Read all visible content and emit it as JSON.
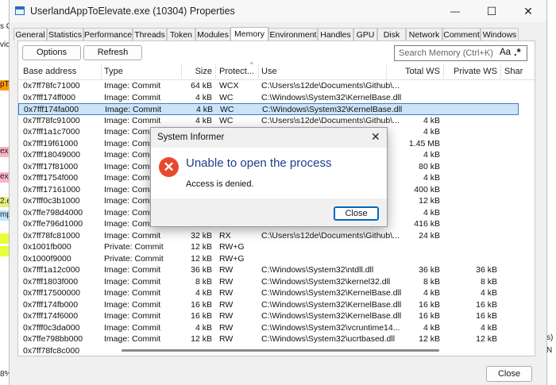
{
  "window": {
    "title": "UserlandAppToElevate.exe (10304) Properties",
    "minimize": "—",
    "maximize": "☐",
    "close": "✕"
  },
  "tabs": [
    {
      "label": "General"
    },
    {
      "label": "Statistics"
    },
    {
      "label": "Performance"
    },
    {
      "label": "Threads"
    },
    {
      "label": "Token"
    },
    {
      "label": "Modules"
    },
    {
      "label": "Memory"
    },
    {
      "label": "Environment"
    },
    {
      "label": "Handles"
    },
    {
      "label": "GPU"
    },
    {
      "label": "Disk"
    },
    {
      "label": "Network"
    },
    {
      "label": "Comment"
    },
    {
      "label": "Windows"
    }
  ],
  "active_tab": "Memory",
  "toolbar": {
    "options_label": "Options",
    "refresh_label": "Refresh",
    "search_placeholder": "Search Memory (Ctrl+K)",
    "case_toggle": "Aa",
    "regex_toggle": ".*"
  },
  "columns": {
    "base_address": "Base address",
    "type": "Type",
    "size": "Size",
    "protection": "Protect...",
    "use": "Use",
    "total_ws": "Total WS",
    "private_ws": "Private WS",
    "shared": "Shar"
  },
  "rows": [
    {
      "base": "0x7ff78fc71000",
      "type": "Image: Commit",
      "size": "64 kB",
      "prot": "WCX",
      "use": "C:\\Users\\s12de\\Documents\\Github\\...",
      "total": "",
      "priv": ""
    },
    {
      "base": "0x7fff174ff000",
      "type": "Image: Commit",
      "size": "4 kB",
      "prot": "WC",
      "use": "C:\\Windows\\System32\\KernelBase.dll",
      "total": "",
      "priv": ""
    },
    {
      "base": "0x7fff174fa000",
      "type": "Image: Commit",
      "size": "4 kB",
      "prot": "WC",
      "use": "C:\\Windows\\System32\\KernelBase.dll",
      "total": "",
      "priv": ""
    },
    {
      "base": "0x7ff78fc91000",
      "type": "Image: Commit",
      "size": "4 kB",
      "prot": "WC",
      "use": "C:\\Users\\s12de\\Documents\\Github\\...",
      "total": "4 kB",
      "priv": ""
    },
    {
      "base": "0x7fff1a1c7000",
      "type": "Image: Commit",
      "size": "",
      "prot": "",
      "use": "",
      "total": "4 kB",
      "priv": ""
    },
    {
      "base": "0x7fff19f61000",
      "type": "Image: Commit",
      "size": "",
      "prot": "",
      "use": "",
      "total": "1.45 MB",
      "priv": ""
    },
    {
      "base": "0x7fff18049000",
      "type": "Image: Commit",
      "size": "",
      "prot": "",
      "use": "",
      "total": "4 kB",
      "priv": ""
    },
    {
      "base": "0x7fff17f81000",
      "type": "Image: Commit",
      "size": "",
      "prot": "",
      "use": "",
      "total": "80 kB",
      "priv": ""
    },
    {
      "base": "0x7fff1754f000",
      "type": "Image: Commit",
      "size": "",
      "prot": "",
      "use": "",
      "total": "4 kB",
      "priv": ""
    },
    {
      "base": "0x7fff17161000",
      "type": "Image: Commit",
      "size": "",
      "prot": "",
      "use": "",
      "total": "400 kB",
      "priv": ""
    },
    {
      "base": "0x7fff0c3b1000",
      "type": "Image: Commit",
      "size": "",
      "prot": "",
      "use": "",
      "total": "12 kB",
      "priv": ""
    },
    {
      "base": "0x7ffe798d4000",
      "type": "Image: Commit",
      "size": "",
      "prot": "",
      "use": "",
      "total": "4 kB",
      "priv": ""
    },
    {
      "base": "0x7ffe796d1000",
      "type": "Image: Commit",
      "size": "",
      "prot": "",
      "use": "",
      "total": "416 kB",
      "priv": ""
    },
    {
      "base": "0x7ff78fc81000",
      "type": "Image: Commit",
      "size": "32 kB",
      "prot": "RX",
      "use": "C:\\Users\\s12de\\Documents\\Github\\...",
      "total": "24 kB",
      "priv": ""
    },
    {
      "base": "0x1001fb000",
      "type": "Private: Commit",
      "size": "12 kB",
      "prot": "RW+G",
      "use": "",
      "total": "",
      "priv": ""
    },
    {
      "base": "0x1000f9000",
      "type": "Private: Commit",
      "size": "12 kB",
      "prot": "RW+G",
      "use": "",
      "total": "",
      "priv": ""
    },
    {
      "base": "0x7fff1a12c000",
      "type": "Image: Commit",
      "size": "36 kB",
      "prot": "RW",
      "use": "C:\\Windows\\System32\\ntdll.dll",
      "total": "36 kB",
      "priv": "36 kB"
    },
    {
      "base": "0x7fff1803f000",
      "type": "Image: Commit",
      "size": "8 kB",
      "prot": "RW",
      "use": "C:\\Windows\\System32\\kernel32.dll",
      "total": "8 kB",
      "priv": "8 kB"
    },
    {
      "base": "0x7fff17500000",
      "type": "Image: Commit",
      "size": "4 kB",
      "prot": "RW",
      "use": "C:\\Windows\\System32\\KernelBase.dll",
      "total": "4 kB",
      "priv": "4 kB"
    },
    {
      "base": "0x7fff174fb000",
      "type": "Image: Commit",
      "size": "16 kB",
      "prot": "RW",
      "use": "C:\\Windows\\System32\\KernelBase.dll",
      "total": "16 kB",
      "priv": "16 kB"
    },
    {
      "base": "0x7fff174f6000",
      "type": "Image: Commit",
      "size": "16 kB",
      "prot": "RW",
      "use": "C:\\Windows\\System32\\KernelBase.dll",
      "total": "16 kB",
      "priv": "16 kB"
    },
    {
      "base": "0x7fff0c3da000",
      "type": "Image: Commit",
      "size": "4 kB",
      "prot": "RW",
      "use": "C:\\Windows\\System32\\vcruntime14...",
      "total": "4 kB",
      "priv": "4 kB"
    },
    {
      "base": "0x7ffe798bb000",
      "type": "Image: Commit",
      "size": "12 kB",
      "prot": "RW",
      "use": "C:\\Windows\\System32\\ucrtbased.dll",
      "total": "12 kB",
      "priv": "12 kB"
    },
    {
      "base": "0x7ff78fc8c000",
      "type": "",
      "size": "",
      "prot": "",
      "use": "",
      "total": "",
      "priv": ""
    }
  ],
  "selected_row_index": 2,
  "dialog": {
    "title": "System Informer",
    "heading": "Unable to open the process",
    "message": "Access is denied.",
    "close_label": "Close",
    "x": "✕"
  },
  "footer": {
    "close_label": "Close"
  },
  "background_fragments": [
    {
      "text": "s C",
      "color": "#ffffff"
    },
    {
      "text": "vic",
      "color": "#ffffff"
    },
    {
      "text": "pTo",
      "color": "#ff9900"
    },
    {
      "text": "exp",
      "color": "#ffb3c6"
    },
    {
      "text": "exe",
      "color": "#ffb3c6"
    },
    {
      "text": "2.e",
      "color": "#e6f07a"
    },
    {
      "text": "mp",
      "color": "#bfe6ff"
    },
    {
      "text": "",
      "color": "#e8ff3a"
    },
    {
      "text": "",
      "color": "#e8ff3a"
    },
    {
      "text": "8%",
      "color": "#ffffff"
    }
  ],
  "right_fragments": [
    "s)",
    "N"
  ]
}
